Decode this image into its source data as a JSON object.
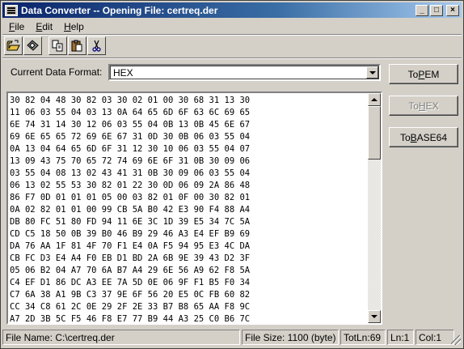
{
  "window": {
    "title": "Data Converter -- Opening File: certreq.der",
    "minimize_glyph": "_",
    "maximize_glyph": "□",
    "close_glyph": "×"
  },
  "menu": [
    {
      "label": "File",
      "accel": "F",
      "rest": "ile"
    },
    {
      "label": "Edit",
      "accel": "E",
      "rest": "dit"
    },
    {
      "label": "Help",
      "accel": "H",
      "rest": "elp"
    }
  ],
  "toolbar": {
    "icons": [
      "open-folder-icon",
      "save-disk-icon",
      "copy-icon",
      "paste-icon",
      "cut-scissors-icon"
    ]
  },
  "format": {
    "label": "Current Data Format:",
    "value": "HEX"
  },
  "hex_lines": [
    "30 82 04 48 30 82 03 30 02 01 00 30 68 31 13 30",
    "11 06 03 55 04 03 13 0A 64 65 6D 6F 63 6C 69 65",
    "6E 74 31 14 30 12 06 03 55 04 0B 13 0B 45 6E 67",
    "69 6E 65 65 72 69 6E 67 31 0D 30 0B 06 03 55 04",
    "0A 13 04 64 65 6D 6F 31 12 30 10 06 03 55 04 07",
    "13 09 43 75 70 65 72 74 69 6E 6F 31 0B 30 09 06",
    "03 55 04 08 13 02 43 41 31 0B 30 09 06 03 55 04",
    "06 13 02 55 53 30 82 01 22 30 0D 06 09 2A 86 48",
    "86 F7 0D 01 01 01 05 00 03 82 01 0F 00 30 82 01",
    "0A 02 82 01 01 00 99 CB 5A B0 42 E3 90 F4 88 A4",
    "DB 80 FC 51 80 FD 94 11 6E 3C 1D 39 E5 34 7C 5A",
    "CD C5 18 50 0B 39 B0 46 B9 29 46 A3 E4 EF B9 69",
    "DA 76 AA 1F 81 4F 70 F1 E4 0A F5 94 95 E3 4C DA",
    "CB FC D3 E4 A4 F0 EB D1 BD 2A 6B 9E 39 43 D2 3F",
    "05 06 B2 04 A7 70 6A B7 A4 29 6E 56 A9 62 F8 5A",
    "C4 EF D1 86 DC A3 EE 7A 5D 0E 06 9F F1 B5 F0 34",
    "C7 6A 38 A1 9B C3 37 9E 6F 56 20 E5 0C FB 60 82",
    "CC 34 C8 61 2C 0E 29 2F 2E 33 B7 B8 65 AA F8 9C",
    "A7 2D 3B 5C F5 46 F8 E7 77 B9 44 A3 25 C0 B6 7C"
  ],
  "buttons": {
    "to_pem": {
      "label": "To PEM",
      "pre": "To ",
      "accel": "P",
      "post": "EM"
    },
    "to_hex": {
      "label": "To HEX",
      "pre": "To ",
      "accel": "H",
      "post": "EX"
    },
    "to_base64": {
      "label": "To BASE64",
      "pre": "To ",
      "accel": "B",
      "post": "ASE64"
    }
  },
  "status": {
    "file_name": "File Name: C:\\certreq.der",
    "file_size": "File Size: 1100 (byte)",
    "total_lines": "TotLn:69",
    "line": "Ln:1",
    "column": "Col:1"
  }
}
